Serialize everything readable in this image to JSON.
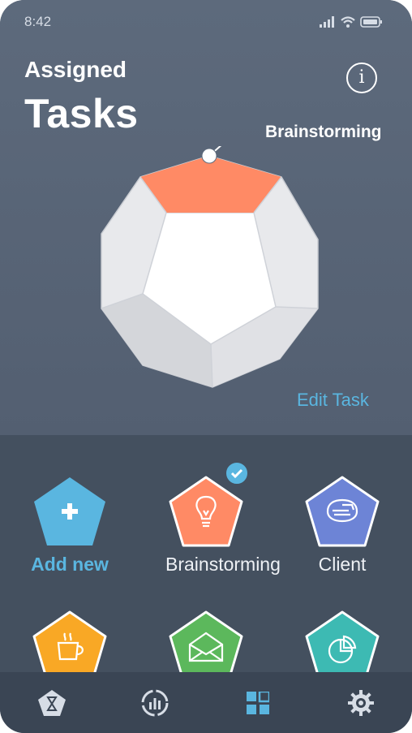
{
  "status_bar": {
    "time": "8:42"
  },
  "header": {
    "title_small": "Assigned",
    "title_big": "Tasks",
    "info_label": "i"
  },
  "model": {
    "highlight_label": "Brainstorming",
    "edit_label": "Edit Task"
  },
  "tiles": [
    {
      "label": "Add new",
      "icon": "plus-icon",
      "color": "#5ab6e0",
      "selected": false
    },
    {
      "label": "Brainstorming",
      "icon": "lightbulb-icon",
      "color": "#ff8a65",
      "selected": true
    },
    {
      "label": "Client",
      "icon": "handshake-icon",
      "color": "#6d84d6",
      "selected": false
    },
    {
      "label": "",
      "icon": "coffee-cup-icon",
      "color": "#f9a825",
      "selected": false
    },
    {
      "label": "",
      "icon": "envelope-icon",
      "color": "#5cb85c",
      "selected": false
    },
    {
      "label": "",
      "icon": "pie-chart-icon",
      "color": "#3dbab3",
      "selected": false
    }
  ],
  "nav": [
    {
      "icon": "hourglass-icon",
      "active": false
    },
    {
      "icon": "stats-icon",
      "active": false
    },
    {
      "icon": "grid-icon",
      "active": true
    },
    {
      "icon": "gear-icon",
      "active": false
    }
  ],
  "colors": {
    "accent": "#5ab6e0",
    "highlight": "#ff8a65",
    "background_top": "#5d6a7c",
    "background_bottom": "#44505f"
  }
}
